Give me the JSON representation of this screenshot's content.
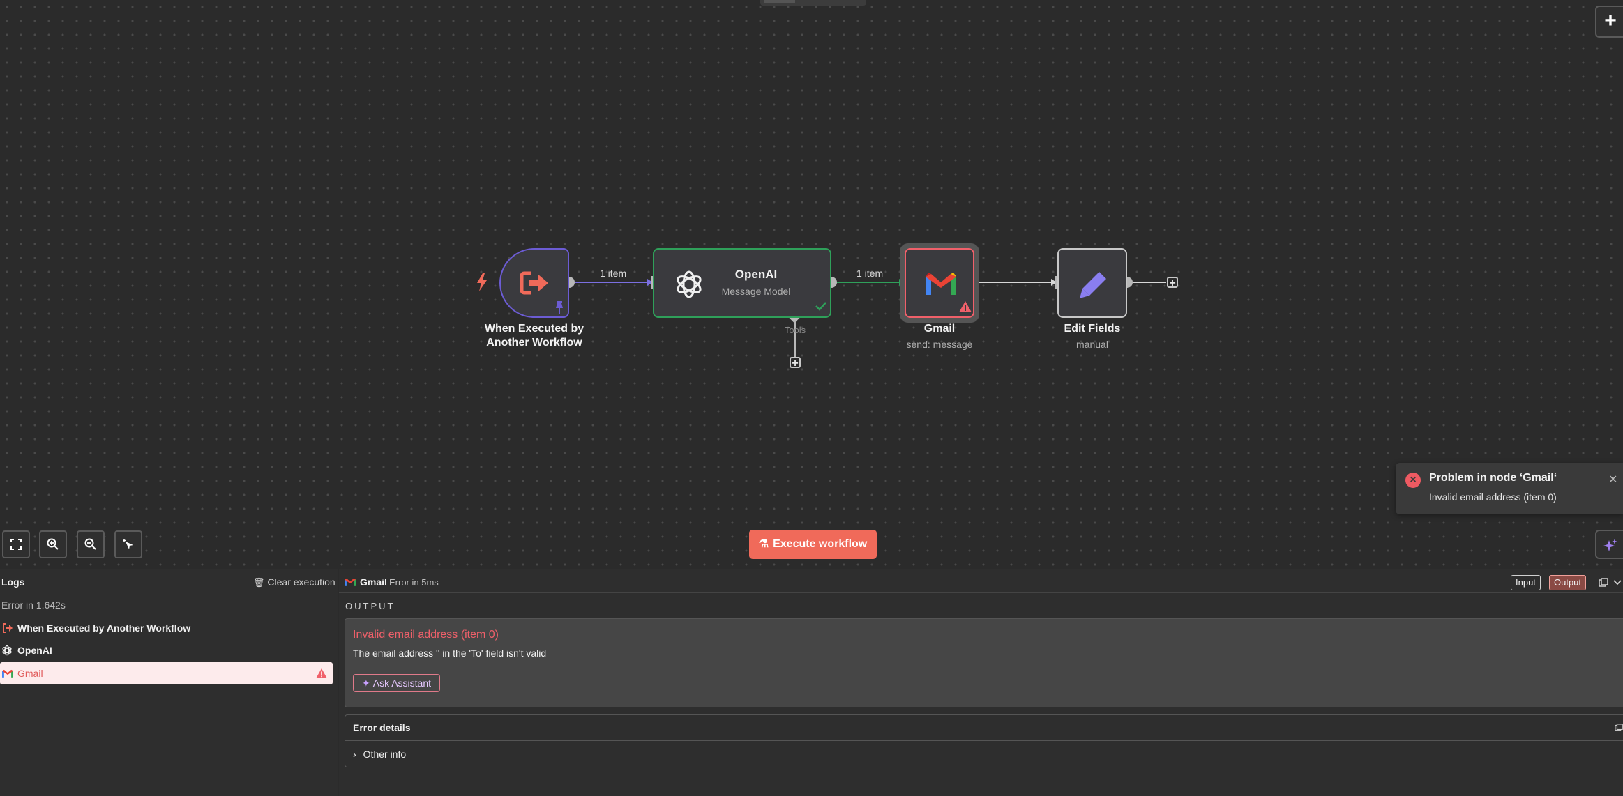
{
  "canvas": {
    "edges": [
      {
        "label": "1 item"
      },
      {
        "label": "1 item"
      }
    ],
    "nodes": {
      "trigger": {
        "label": "When Executed by Another Workflow"
      },
      "openai": {
        "title": "OpenAI",
        "subtitle": "Message Model",
        "connector_label": "Tools"
      },
      "gmail": {
        "label": "Gmail",
        "subtitle": "send: message"
      },
      "edit_fields": {
        "label": "Edit Fields",
        "subtitle": "manual"
      }
    },
    "execute_button": "Execute workflow",
    "colors": {
      "trigger": "#6c5cd4",
      "success": "#2fa05a",
      "error": "#f0606a",
      "accent": "#f06a5a"
    }
  },
  "toast": {
    "title": "Problem in node ‘Gmail‘",
    "message": "Invalid email address (item 0)"
  },
  "logs": {
    "title": "Logs",
    "clear_label": "Clear execution",
    "status": "Error in 1.642s",
    "items": [
      {
        "label": "When Executed by Another Workflow",
        "icon": "trigger-icon"
      },
      {
        "label": "OpenAI",
        "icon": "openai-icon"
      },
      {
        "label": "Gmail",
        "icon": "gmail-icon",
        "state": "error"
      }
    ]
  },
  "detail": {
    "node_name": "Gmail",
    "status": "Error in 5ms",
    "tabs": [
      "Input",
      "Output"
    ],
    "output_title": "OUTPUT",
    "error_title": "Invalid email address (item 0)",
    "error_description": "The email address '' in the 'To' field isn't valid",
    "ask_assistant": "Ask Assistant",
    "error_details_title": "Error details",
    "other_info": "Other info"
  }
}
